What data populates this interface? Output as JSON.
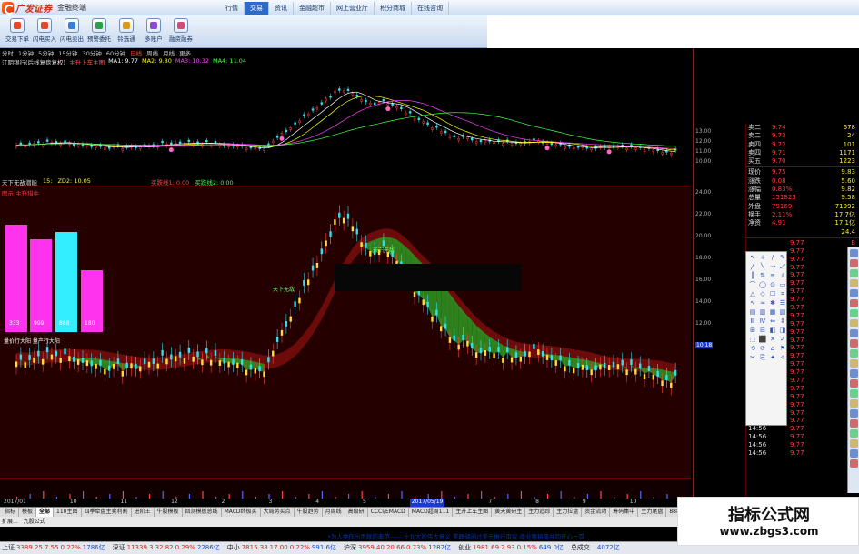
{
  "app": {
    "logo_text": "广发证券",
    "logo_sub": "金融终端",
    "top_nav": [
      "行情",
      "交易",
      "资讯",
      "金融超市",
      "网上营业厅",
      "积分商城",
      "在线咨询"
    ],
    "top_nav_active": 1
  },
  "toolbar": [
    {
      "label": "交易下单",
      "color": "#e24a2b"
    },
    {
      "label": "闪电买入",
      "color": "#e24a2b"
    },
    {
      "label": "闪电卖出",
      "color": "#3a7dd8"
    },
    {
      "label": "预警委托",
      "color": "#2aa04a"
    },
    {
      "label": "铃选通",
      "color": "#d89a1b"
    },
    {
      "label": "多账户",
      "color": "#8a4bd0"
    },
    {
      "label": "融资融券",
      "color": "#d04b7a"
    }
  ],
  "periods": [
    "分时",
    "1分钟",
    "5分钟",
    "15分钟",
    "30分钟",
    "60分钟",
    "日线",
    "周线",
    "月线",
    "更多"
  ],
  "period_active": 6,
  "upper_header": {
    "title": "江阴银行(后线复盘复权)",
    "indicator": "主升上车主图",
    "ma": [
      {
        "label": "MA1: 9.77",
        "color": "#ffffff"
      },
      {
        "label": "MA2: 9.80",
        "color": "#ffff00"
      },
      {
        "label": "MA3: 10.32",
        "color": "#ff44ff"
      },
      {
        "label": "MA4: 11.04",
        "color": "#44ff44"
      }
    ]
  },
  "right_axis": {
    "upper_ticks": [
      "13.00",
      "12.00",
      "11.00",
      "10.00"
    ],
    "lower_ticks": [
      "24.00",
      "22.00",
      "20.00",
      "18.00",
      "16.00",
      "14.00",
      "12.00",
      "10.18"
    ]
  },
  "sub_header": {
    "name": "天下无敌潜能",
    "v1": "15:",
    "v2": "ZD2: 10.05",
    "s1": "买跌线1: 0.00",
    "s2": "买跌线2: 0.00",
    "lower_title": "图示 主升猎牛",
    "bar_labels": [
      "333",
      "999",
      "888",
      "180"
    ],
    "anno1": "天下无敌",
    "anno2": "天下无敌",
    "anno3": "量价行大阳 量产行大阳"
  },
  "quote": {
    "rows": [
      {
        "label": "卖二",
        "price": "9.74",
        "vol": "678"
      },
      {
        "label": "卖二",
        "price": "9.73",
        "vol": "24"
      },
      {
        "label": "卖四",
        "price": "9.72",
        "vol": "101"
      },
      {
        "label": "卖四",
        "price": "9.71",
        "vol": "1171"
      },
      {
        "label": "买五",
        "price": "9.70",
        "vol": "1223"
      },
      {
        "label": "现价",
        "price": "9.75",
        "vol": "9.83"
      },
      {
        "label": "涨跌",
        "price": "0.08",
        "vol": "5.60"
      },
      {
        "label": "涨幅",
        "price": "0.83%",
        "vol": "9.82"
      },
      {
        "label": "总量",
        "price": "151823",
        "vol": "9.58"
      },
      {
        "label": "外盘",
        "price": "79169",
        "vol": "71992"
      },
      {
        "label": "换手",
        "price": "2.11%",
        "vol": "17.7亿"
      },
      {
        "label": "净资",
        "price": "4.91",
        "vol": "17.1亿"
      },
      {
        "label": "",
        "price": "",
        "vol": "24.4"
      }
    ],
    "ticks": [
      {
        "t": "",
        "p": "9.77",
        "v": "B"
      },
      {
        "t": "",
        "p": "9.77",
        "v": "S"
      },
      {
        "t": "",
        "p": "9.77",
        "v": "S"
      },
      {
        "t": "",
        "p": "9.77",
        "v": "B"
      },
      {
        "t": "",
        "p": "9.77",
        "v": "S"
      },
      {
        "t": "",
        "p": "9.77",
        "v": "S"
      },
      {
        "t": "",
        "p": "9.77",
        "v": "B"
      },
      {
        "t": "",
        "p": "9.77",
        "v": "S"
      },
      {
        "t": "",
        "p": "9.77",
        "v": "B"
      },
      {
        "t": "",
        "p": "9.77",
        "v": "S"
      },
      {
        "t": "",
        "p": "9.77",
        "v": "S"
      },
      {
        "t": "",
        "p": "9.77",
        "v": "B"
      },
      {
        "t": "",
        "p": "9.77",
        "v": "S"
      },
      {
        "t": "",
        "p": "9.77",
        "v": "S"
      },
      {
        "t": "",
        "p": "9.77",
        "v": "B"
      },
      {
        "t": "",
        "p": "9.77",
        "v": "S"
      },
      {
        "t": "",
        "p": "9.77",
        "v": "S"
      },
      {
        "t": "",
        "p": "9.77",
        "v": "B"
      },
      {
        "t": "",
        "p": "9.77",
        "v": "S"
      },
      {
        "t": "14:56",
        "p": "9.77",
        "v": "S"
      },
      {
        "t": "14:56",
        "p": "9.77",
        "v": "S"
      },
      {
        "t": "14:56",
        "p": "9.77",
        "v": "B"
      },
      {
        "t": "14:56",
        "p": "9.77",
        "v": "S"
      },
      {
        "t": "14:56",
        "p": "9.77",
        "v": "S"
      },
      {
        "t": "14:56",
        "p": "9.77",
        "v": "S"
      },
      {
        "t": "14:56",
        "p": "9.77",
        "v": "S"
      },
      {
        "t": "14:56",
        "p": "9.77",
        "v": "S"
      }
    ]
  },
  "time_axis": [
    "2017/01",
    "10",
    "11",
    "12",
    "2",
    "3",
    "4",
    "5",
    "2017/05/19",
    "7",
    "8",
    "9",
    "10",
    "11"
  ],
  "tabs": [
    "指标",
    "模板",
    "全部",
    "110主图",
    "四季牵盘主卖利割",
    "进阶王",
    "牛股模板",
    "回测模板总线",
    "MACD终极买",
    "大局势买点",
    "牛股趋势",
    "月周线",
    "高级研",
    "CCCI/EMACD",
    "MACD超周111",
    "主升上车主图",
    "黄天黄研主",
    "主力追踪",
    "主力拉盘",
    "资金流动",
    "筹码集中",
    "主力尾盘",
    "888888",
    "鲁谷高胜率",
    "不抛看拿主",
    "逐"
  ],
  "tab_active": 2,
  "tab_row2": [
    "扩展...",
    "九股公式"
  ],
  "news": "•为人类作出贡献的典范—— 十九大的伟大意义     美联储通过美元推行审议  商业赛将落共同开心一首",
  "status": [
    {
      "name": "上证",
      "val": "3389.25",
      "chg": "7.55",
      "pct": "0.22%",
      "vol": "1786亿"
    },
    {
      "name": "深证",
      "val": "11339.3",
      "chg": "32.82",
      "pct": "0.29%",
      "vol": "2286亿"
    },
    {
      "name": "中小",
      "val": "7815.38",
      "chg": "17.00",
      "pct": "0.22%",
      "vol": "991.6亿"
    },
    {
      "name": "沪深",
      "val": "3959.40",
      "chg": "20.66",
      "pct": "0.73%",
      "vol": "1282亿"
    },
    {
      "name": "创业",
      "val": "1981.69",
      "chg": "2.93",
      "pct": "0.15%",
      "vol": "649.0亿"
    },
    {
      "name": "总成交",
      "val": "",
      "chg": "",
      "pct": "",
      "vol": "4072亿"
    }
  ],
  "draw_tools": [
    "↖",
    "+",
    "/",
    "✎",
    "╱",
    "╲",
    "⇢",
    "⤢",
    "║",
    "⇅",
    "≡",
    "⫽",
    "⌒",
    "◯",
    "⊙",
    "▭",
    "△",
    "◇",
    "☐",
    "⌗",
    "∿",
    "≈",
    "✱",
    "☰",
    "▤",
    "▥",
    "▦",
    "▧",
    "Ⅲ",
    "Ⅳ",
    "⇔",
    "⇕",
    "⊞",
    "⊟",
    "◧",
    "◨",
    "⬚",
    "⬛",
    "✕",
    "✓",
    "⟲",
    "⟳",
    "⌂",
    "⚑",
    "✂",
    "⎘",
    "✦",
    "✧"
  ],
  "watermark": {
    "title": "指标公式网",
    "url": "www.zbgs3.com"
  }
}
